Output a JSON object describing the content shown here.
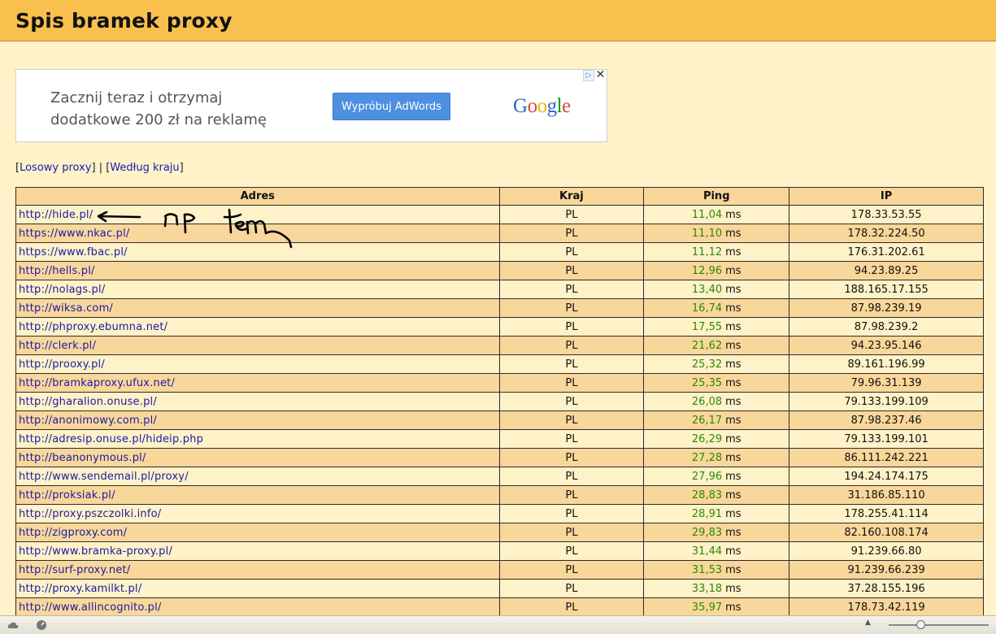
{
  "header": {
    "title": "Spis bramek proxy"
  },
  "ad": {
    "line1": "Zacznij teraz i otrzymaj",
    "line2": "dodatkowe 200 zł na reklamę",
    "button_label": "Wypróbuj AdWords",
    "logo": [
      "G",
      "o",
      "o",
      "g",
      "l",
      "e"
    ],
    "logo_colors": [
      "#3366cc",
      "#dd4b39",
      "#f2b400",
      "#3366cc",
      "#009933",
      "#dd4b39"
    ],
    "choices_icon": "▷",
    "close_icon": "✕"
  },
  "nav": {
    "open1": "[",
    "random_label": "Losowy proxy",
    "close1": "]",
    "sep": " | ",
    "open2": "[",
    "country_label": "Według kraju",
    "close2": "]"
  },
  "table": {
    "headers": [
      "Adres",
      "Kraj",
      "Ping",
      "IP"
    ],
    "unit": "ms",
    "rows": [
      {
        "url": "http://hide.pl/",
        "country": "PL",
        "ping": "11,04",
        "ip": "178.33.53.55"
      },
      {
        "url": "https://www.nkac.pl/",
        "country": "PL",
        "ping": "11,10",
        "ip": "178.32.224.50"
      },
      {
        "url": "https://www.fbac.pl/",
        "country": "PL",
        "ping": "11,12",
        "ip": "176.31.202.61"
      },
      {
        "url": "http://hells.pl/",
        "country": "PL",
        "ping": "12,96",
        "ip": "94.23.89.25"
      },
      {
        "url": "http://nolags.pl/",
        "country": "PL",
        "ping": "13,40",
        "ip": "188.165.17.155"
      },
      {
        "url": "http://wiksa.com/",
        "country": "PL",
        "ping": "16,74",
        "ip": "87.98.239.19"
      },
      {
        "url": "http://phproxy.ebumna.net/",
        "country": "PL",
        "ping": "17,55",
        "ip": "87.98.239.2"
      },
      {
        "url": "http://clerk.pl/",
        "country": "PL",
        "ping": "21,62",
        "ip": "94.23.95.146"
      },
      {
        "url": "http://prooxy.pl/",
        "country": "PL",
        "ping": "25,32",
        "ip": "89.161.196.99"
      },
      {
        "url": "http://bramkaproxy.ufux.net/",
        "country": "PL",
        "ping": "25,35",
        "ip": "79.96.31.139"
      },
      {
        "url": "http://gharalion.onuse.pl/",
        "country": "PL",
        "ping": "26,08",
        "ip": "79.133.199.109"
      },
      {
        "url": "http://anonimowy.com.pl/",
        "country": "PL",
        "ping": "26,17",
        "ip": "87.98.237.46"
      },
      {
        "url": "http://adresip.onuse.pl/hideip.php",
        "country": "PL",
        "ping": "26,29",
        "ip": "79.133.199.101"
      },
      {
        "url": "http://beanonymous.pl/",
        "country": "PL",
        "ping": "27,28",
        "ip": "86.111.242.221"
      },
      {
        "url": "http://www.sendemail.pl/proxy/",
        "country": "PL",
        "ping": "27,96",
        "ip": "194.24.174.175"
      },
      {
        "url": "http://proksiak.pl/",
        "country": "PL",
        "ping": "28,83",
        "ip": "31.186.85.110"
      },
      {
        "url": "http://proxy.pszczolki.info/",
        "country": "PL",
        "ping": "28,91",
        "ip": "178.255.41.114"
      },
      {
        "url": "http://zigproxy.com/",
        "country": "PL",
        "ping": "29,83",
        "ip": "82.160.108.174"
      },
      {
        "url": "http://www.bramka-proxy.pl/",
        "country": "PL",
        "ping": "31,44",
        "ip": "91.239.66.80"
      },
      {
        "url": "http://surf-proxy.net/",
        "country": "PL",
        "ping": "31,53",
        "ip": "91.239.66.239"
      },
      {
        "url": "http://proxy.kamilkt.pl/",
        "country": "PL",
        "ping": "33,18",
        "ip": "37.28.155.196"
      },
      {
        "url": "http://www.allincognito.pl/",
        "country": "PL",
        "ping": "35,97",
        "ip": "178.73.42.119"
      }
    ]
  },
  "annotation": {
    "handwritten_text": "np tem"
  },
  "statusbar": {
    "icons": [
      "cloud-icon",
      "speedometer-icon",
      "scroll-up-icon"
    ]
  }
}
